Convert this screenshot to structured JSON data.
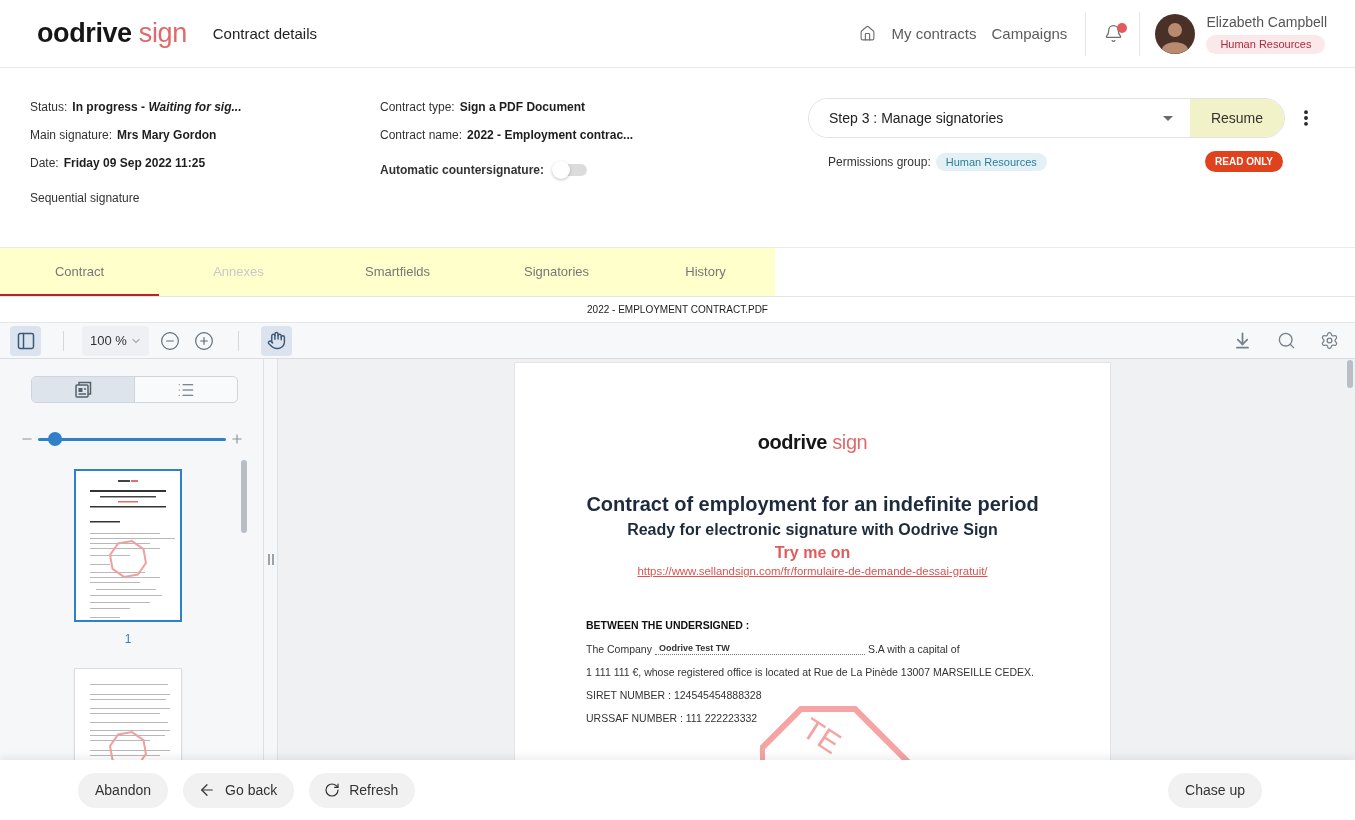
{
  "header": {
    "logo": {
      "brand": "oodrive",
      "product": "sign"
    },
    "title": "Contract details",
    "nav": [
      "My contracts",
      "Campaigns"
    ],
    "notifications": {
      "unread": true
    },
    "user": {
      "name": "Elizabeth Campbell",
      "role": "Human Resources"
    }
  },
  "details": {
    "columns": [
      {
        "items": [
          {
            "kind": "field",
            "label": "Status:",
            "value": "In progress - *Waiting for sig...*"
          },
          {
            "kind": "field",
            "label": "Main signature:",
            "value": "Mrs Mary Gordon"
          },
          {
            "kind": "field",
            "label": "Date:",
            "value": "Friday 09 Sep 2022 11:25"
          },
          {
            "kind": "note",
            "text": "Sequential signature"
          }
        ]
      },
      {
        "items": [
          {
            "kind": "field",
            "label": "Contract type:",
            "value": "Sign a PDF Document"
          },
          {
            "kind": "field",
            "label": "Contract name:",
            "value": "2022 - Employment contrac..."
          },
          {
            "kind": "toggle",
            "label": "Automatic countersignature:",
            "on": false
          }
        ]
      }
    ]
  },
  "workflow": {
    "step": "Step 3 : Manage signatories",
    "action": "Resume",
    "permissions_label": "Permissions group:",
    "permissions_group": "Human Resources",
    "access": "READ ONLY"
  },
  "tabs": [
    {
      "label": "Contract",
      "selected": true,
      "disabled": false
    },
    {
      "label": "Annexes",
      "selected": false,
      "disabled": true
    },
    {
      "label": "Smartfields",
      "selected": false,
      "disabled": false
    },
    {
      "label": "Signatories",
      "selected": false,
      "disabled": false
    },
    {
      "label": "History",
      "selected": false,
      "disabled": false
    }
  ],
  "viewer": {
    "filename": "2022 - EMPLOYMENT CONTRACT.PDF",
    "toolbar": {
      "sidebar_open": true,
      "zoom": "100 %",
      "hand_tool": true
    },
    "sidebar": {
      "views": [
        {
          "kind": "thumbnails",
          "selected": true
        },
        {
          "kind": "outline",
          "selected": false
        }
      ],
      "size_slider": {
        "level": 0.09
      },
      "pages": [
        {
          "label": "1",
          "selected": true
        },
        {
          "selected": false
        }
      ]
    },
    "document": {
      "logo": {
        "brand": "oodrive",
        "product": "sign"
      },
      "title": "Contract of employment for an indefinite period",
      "subtitle": "Ready for electronic signature with Oodrive Sign",
      "cta": "Try me on",
      "link": "https://www.sellandsign.com/fr/formulaire-de-demande-dessai-gratuit/",
      "section": "BETWEEN THE UNDERSIGNED :",
      "company": {
        "before": "The Company",
        "value": "Oodrive Test TW",
        "after": "S.A with a capital of"
      },
      "lines": [
        "1 111 111 €, whose registered office is located at Rue de La Pinède 13007 MARSEILLE CEDEX.",
        "SIRET NUMBER : 124545454888328",
        "URSSAF NUMBER : 111 222223332"
      ],
      "stamp": "TE"
    }
  },
  "footer": {
    "left": [
      {
        "kind": "plain",
        "label": "Abandon"
      },
      {
        "kind": "back",
        "label": "Go back"
      },
      {
        "kind": "refresh",
        "label": "Refresh"
      }
    ],
    "right": [
      {
        "kind": "plain",
        "label": "Chase up"
      }
    ]
  }
}
